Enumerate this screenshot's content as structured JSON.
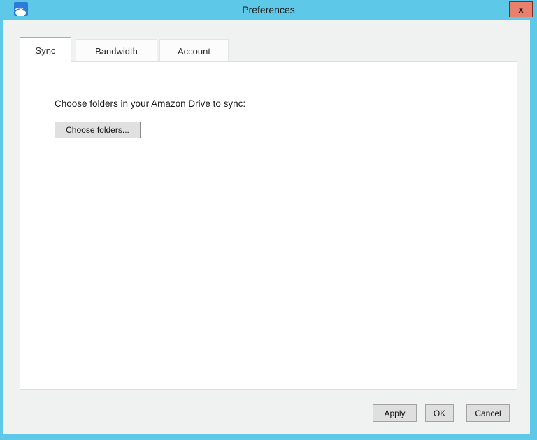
{
  "window": {
    "title": "Preferences",
    "close_label": "x",
    "titlebar_color": "#5dc8e8",
    "border_color": "#5dc8e8",
    "close_button_color": "#e8806d",
    "app_icon": "amazon-drive-cloud-icon",
    "app_icon_color": "#2c7bd9"
  },
  "tabs": [
    {
      "label": "Sync",
      "active": true
    },
    {
      "label": "Bandwidth",
      "active": false
    },
    {
      "label": "Account",
      "active": false
    }
  ],
  "content": {
    "instruction": "Choose folders in your Amazon Drive to sync:",
    "choose_folders_label": "Choose folders..."
  },
  "footer": {
    "apply_label": "Apply",
    "ok_label": "OK",
    "cancel_label": "Cancel"
  }
}
